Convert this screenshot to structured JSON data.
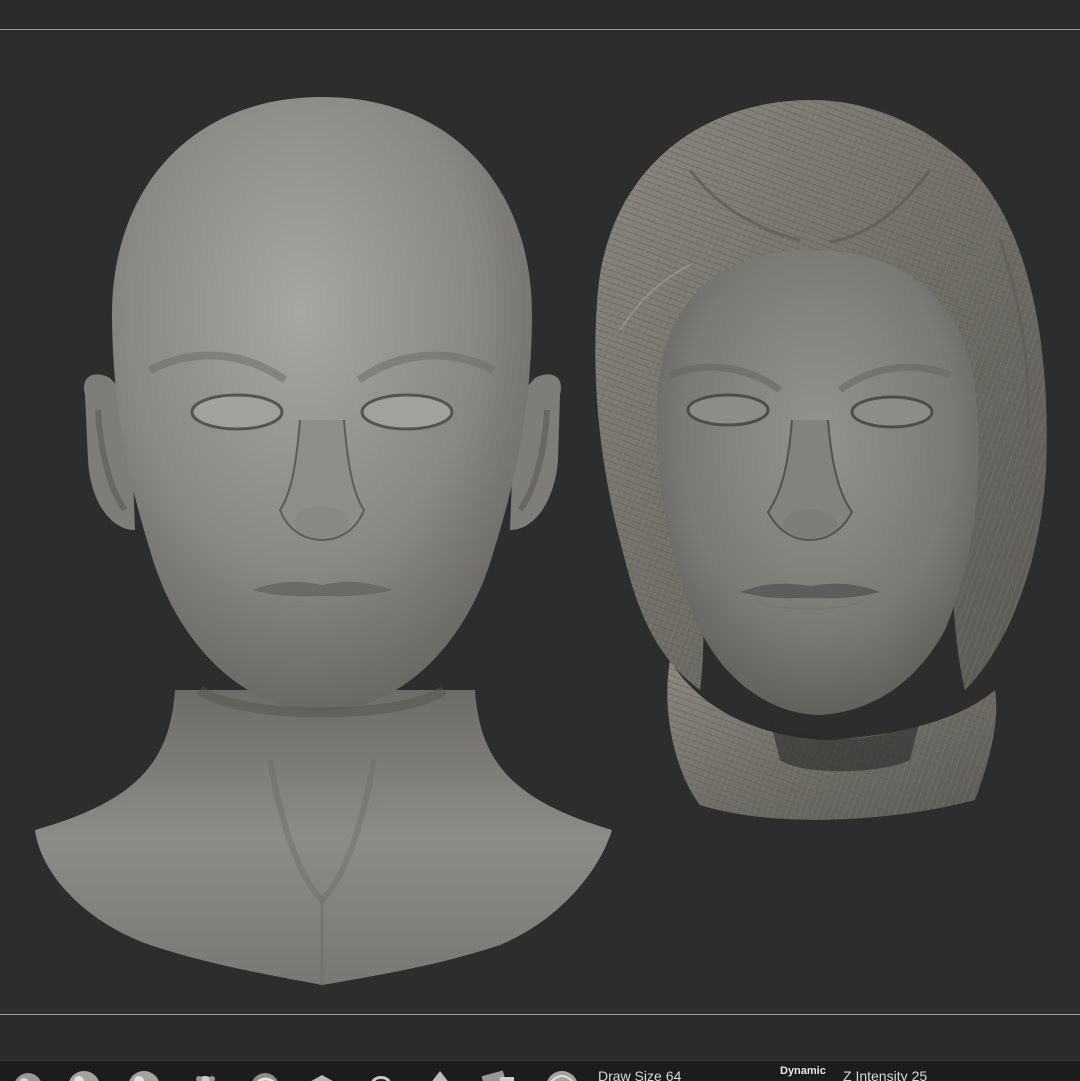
{
  "shelf": {
    "draw_size": {
      "label": "Draw Size",
      "value": "64"
    },
    "dynamic_label": "Dynamic",
    "z_intensity": {
      "label": "Z Intensity",
      "value": "25"
    }
  },
  "viewport": {
    "models": [
      {
        "name": "smooth-head-bust"
      },
      {
        "name": "scanned-head-with-hood"
      }
    ]
  },
  "colors": {
    "background": "#2d2d2d",
    "separator": "#9a9a9a",
    "shelf_bg": "#1c1c1c",
    "clay": "#8c8a86"
  }
}
